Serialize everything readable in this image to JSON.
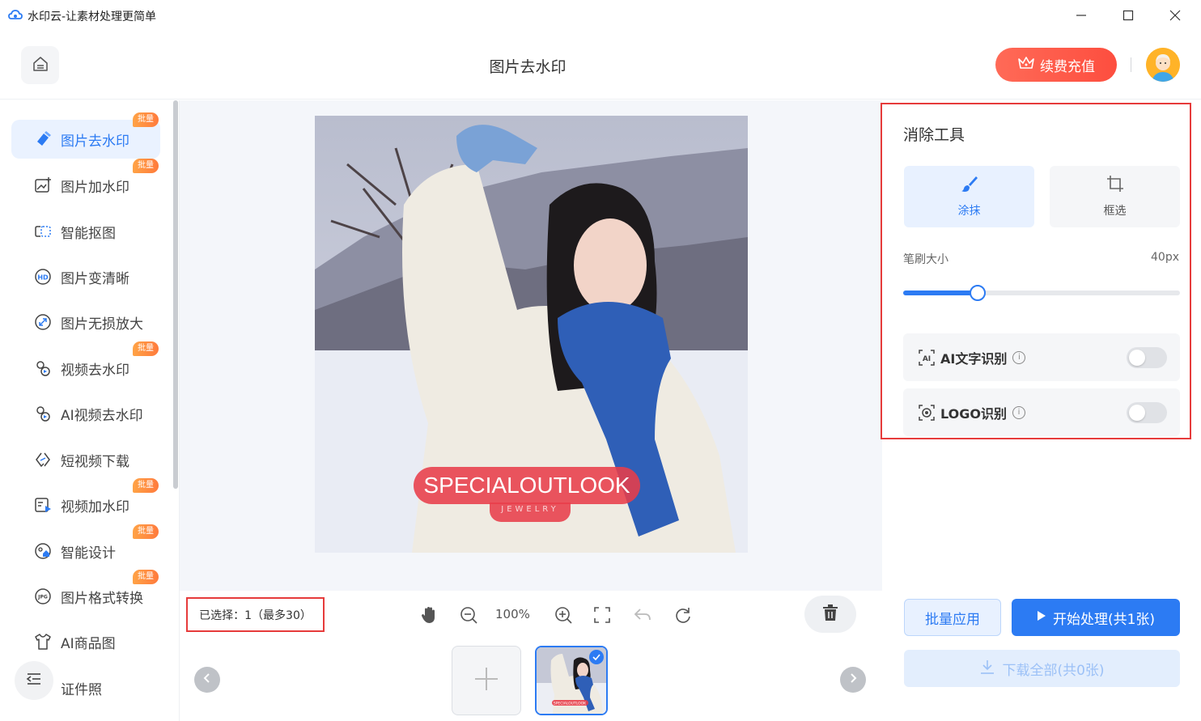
{
  "app": {
    "title": "水印云-让素材处理更简单",
    "icon": "cloud-logo-icon"
  },
  "window_controls": {
    "minimize_icon": "minimize-icon",
    "maximize_icon": "maximize-icon",
    "close_icon": "close-icon"
  },
  "header": {
    "home_icon": "home-icon",
    "page_title": "图片去水印",
    "vip_label": "续费充值",
    "vip_icon": "crown-icon",
    "vip_color": "#fd5a48"
  },
  "sidebar": {
    "items": [
      {
        "label": "图片去水印",
        "icon": "eraser-icon",
        "badge": "批量",
        "active": true
      },
      {
        "label": "图片加水印",
        "icon": "image-add-icon",
        "badge": "批量",
        "active": false
      },
      {
        "label": "智能抠图",
        "icon": "cutout-icon",
        "badge": "",
        "active": false
      },
      {
        "label": "图片变清晰",
        "icon": "hd-icon",
        "badge": "",
        "active": false
      },
      {
        "label": "图片无损放大",
        "icon": "enlarge-icon",
        "badge": "",
        "active": false
      },
      {
        "label": "视频去水印",
        "icon": "video-eraser-icon",
        "badge": "批量",
        "active": false
      },
      {
        "label": "AI视频去水印",
        "icon": "ai-video-icon",
        "badge": "",
        "active": false
      },
      {
        "label": "短视频下载",
        "icon": "link-icon",
        "badge": "",
        "active": false
      },
      {
        "label": "视频加水印",
        "icon": "video-add-icon",
        "badge": "批量",
        "active": false
      },
      {
        "label": "智能设计",
        "icon": "design-icon",
        "badge": "批量",
        "active": false
      },
      {
        "label": "图片格式转换",
        "icon": "jpg-convert-icon",
        "badge": "批量",
        "active": false
      },
      {
        "label": "AI商品图",
        "icon": "shirt-icon",
        "badge": "",
        "active": false
      },
      {
        "label": "证件照",
        "icon": "id-photo-icon",
        "badge": "",
        "active": false
      }
    ],
    "collapse_icon": "menu-collapse-icon"
  },
  "canvas": {
    "watermark_text": "SPECIALOUTLOOK",
    "watermark_subtext": "JEWELRY"
  },
  "bottom_bar": {
    "selected_text": "已选择：1（最多30）",
    "zoom": "100%",
    "tools": [
      "hand-icon",
      "zoom-out-icon",
      "zoom-in-icon",
      "fullscreen-icon",
      "undo-icon",
      "rotate-icon"
    ],
    "delete_icon": "trash-icon",
    "add_icon": "plus-icon",
    "thumb_watermark": "SPECIALOUTLOOK"
  },
  "panel": {
    "title": "消除工具",
    "modes": [
      {
        "label": "涂抹",
        "icon": "brush-icon",
        "active": true
      },
      {
        "label": "框选",
        "icon": "crop-icon",
        "active": false
      }
    ],
    "brush_label": "笔刷大小",
    "brush_value": "40px",
    "brush_fraction": 0.27,
    "options": [
      {
        "label": "AI文字识别",
        "icon": "ai-text-icon",
        "enabled": false
      },
      {
        "label": "LOGO识别",
        "icon": "logo-detect-icon",
        "enabled": false
      }
    ],
    "info_icon": "info-icon",
    "batch_label": "批量应用",
    "start_label": "开始处理(共1张)",
    "start_icon": "play-icon",
    "download_label": "下载全部(共0张)",
    "download_icon": "download-icon",
    "accent": "#2c7bf3"
  }
}
